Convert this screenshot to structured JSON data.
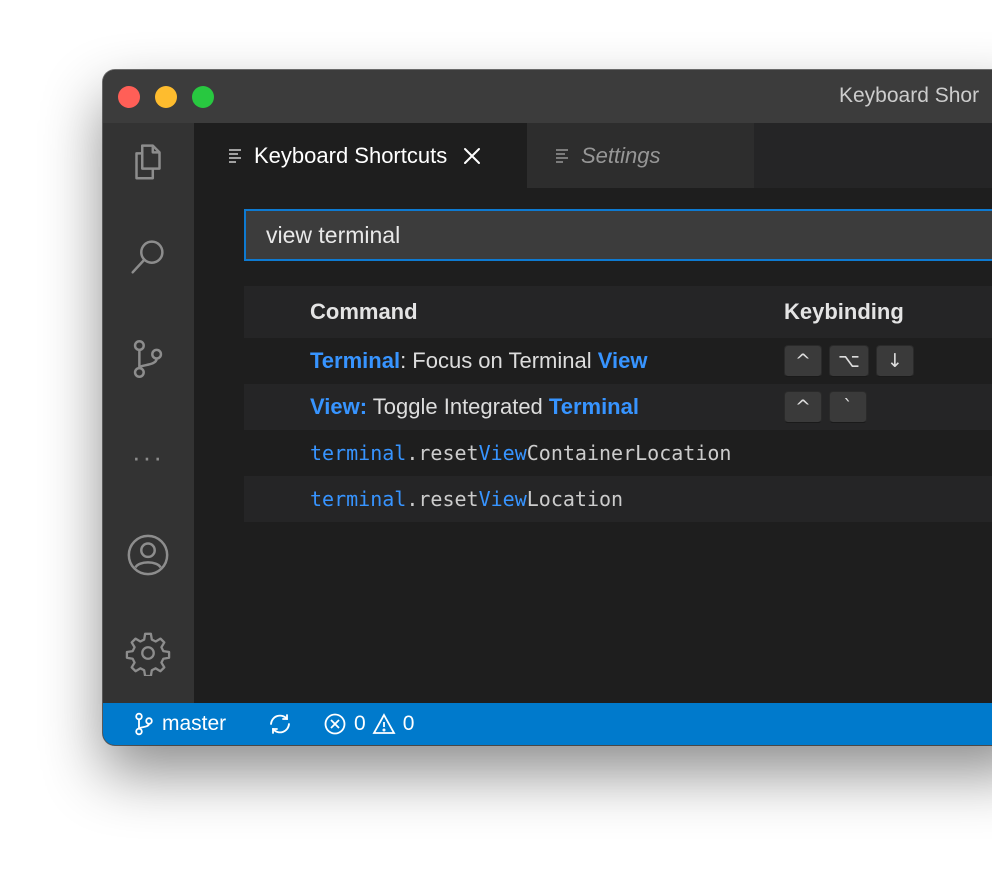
{
  "window": {
    "title": "Keyboard Shor",
    "colors": {
      "accent": "#007acc",
      "highlight": "#3794ff",
      "close": "#ff5f57",
      "minimize": "#febc2e",
      "maximize": "#28c840"
    }
  },
  "activity_bar": {
    "icons": [
      "files-icon",
      "search-icon",
      "source-control-icon",
      "more-icon",
      "account-icon",
      "gear-icon"
    ],
    "more_glyph": "···"
  },
  "tabs": [
    {
      "label": "Keyboard Shortcuts",
      "icon": "lines-icon",
      "active": true,
      "close_glyph": "×"
    },
    {
      "label": "Settings",
      "icon": "lines-icon",
      "active": false
    }
  ],
  "search": {
    "value": "view terminal"
  },
  "table": {
    "headers": {
      "command": "Command",
      "keybinding": "Keybinding"
    },
    "rows": [
      {
        "command": {
          "p1": "Terminal",
          "p2": ": Focus on Terminal ",
          "p3": "View"
        },
        "keys": [
          "^",
          "⌥",
          "↓"
        ]
      },
      {
        "command": {
          "p1": "View:",
          "p2": " Toggle Integrated ",
          "p3": "Terminal"
        },
        "keys": [
          "^",
          "`"
        ]
      },
      {
        "command": {
          "p1": "terminal",
          "p2": ".reset",
          "p3": "View",
          "p4": "ContainerLocation"
        },
        "keys": []
      },
      {
        "command": {
          "p1": "terminal",
          "p2": ".reset",
          "p3": "View",
          "p4": "Location"
        },
        "keys": []
      }
    ]
  },
  "statusbar": {
    "branch": "master",
    "errors": "0",
    "warnings": "0"
  }
}
